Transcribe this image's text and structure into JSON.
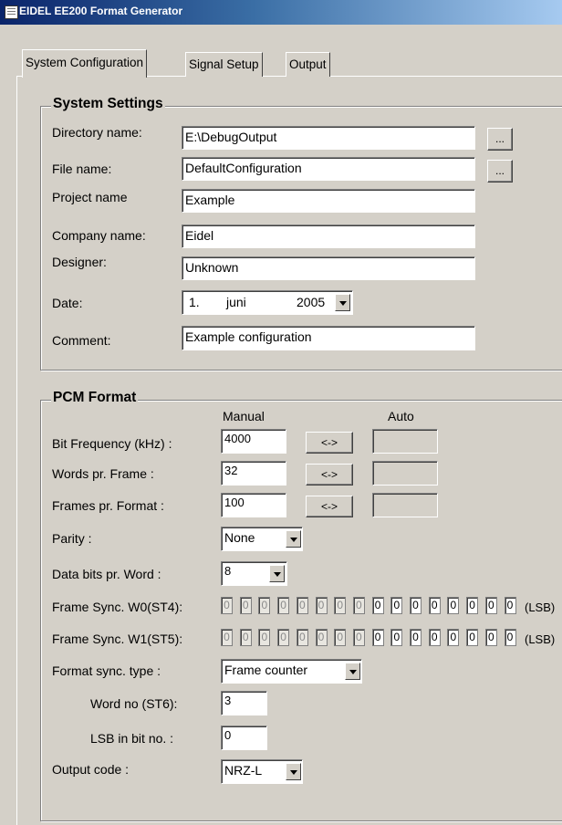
{
  "window": {
    "title": "EIDEL EE200 Format Generator",
    "icon": "grid-app-icon"
  },
  "tabs": [
    {
      "label": "System Configuration"
    },
    {
      "label": "Signal Setup"
    },
    {
      "label": "Output"
    }
  ],
  "system_settings": {
    "title": "System Settings",
    "directory_label": "Directory name:",
    "directory_value": "E:\\DebugOutput",
    "file_label": "File name:",
    "file_value": "DefaultConfiguration",
    "browse_label": "...",
    "project_label": "Project name",
    "project_value": "Example",
    "company_label": "Company name:",
    "company_value": "Eidel",
    "designer_label": "Designer:",
    "designer_value": "Unknown",
    "date_label": "Date:",
    "date_day": "1.",
    "date_month": "juni",
    "date_year": "2005",
    "comment_label": "Comment:",
    "comment_value": "Example configuration"
  },
  "pcm_format": {
    "title": "PCM Format",
    "manual_header": "Manual",
    "auto_header": "Auto",
    "swap_label": "<->",
    "bit_freq_label": "Bit Frequency (kHz) :",
    "bit_freq_value": "4000",
    "words_label": "Words pr. Frame :",
    "words_value": "32",
    "frames_label": "Frames pr. Format :",
    "frames_value": "100",
    "parity_label": "Parity :",
    "parity_value": "None",
    "databits_label": "Data bits pr. Word :",
    "databits_value": "8",
    "fs_w0_label": "Frame Sync. W0(ST4):",
    "fs_w1_label": "Frame Sync. W1(ST5):",
    "lsb_tag": "(LSB)",
    "fs_w0_bits": [
      "0",
      "0",
      "0",
      "0",
      "0",
      "0",
      "0",
      "0",
      "0",
      "0",
      "0",
      "0",
      "0",
      "0",
      "0",
      "0"
    ],
    "fs_w1_bits": [
      "0",
      "0",
      "0",
      "0",
      "0",
      "0",
      "0",
      "0",
      "0",
      "0",
      "0",
      "0",
      "0",
      "0",
      "0",
      "0"
    ],
    "format_sync_label": "Format sync. type :",
    "format_sync_value": "Frame counter",
    "word_no_label": "Word no (ST6):",
    "word_no_value": "3",
    "lsb_bit_label": "LSB in bit no. :",
    "lsb_bit_value": "0",
    "output_code_label": "Output code :",
    "output_code_value": "NRZ-L"
  }
}
